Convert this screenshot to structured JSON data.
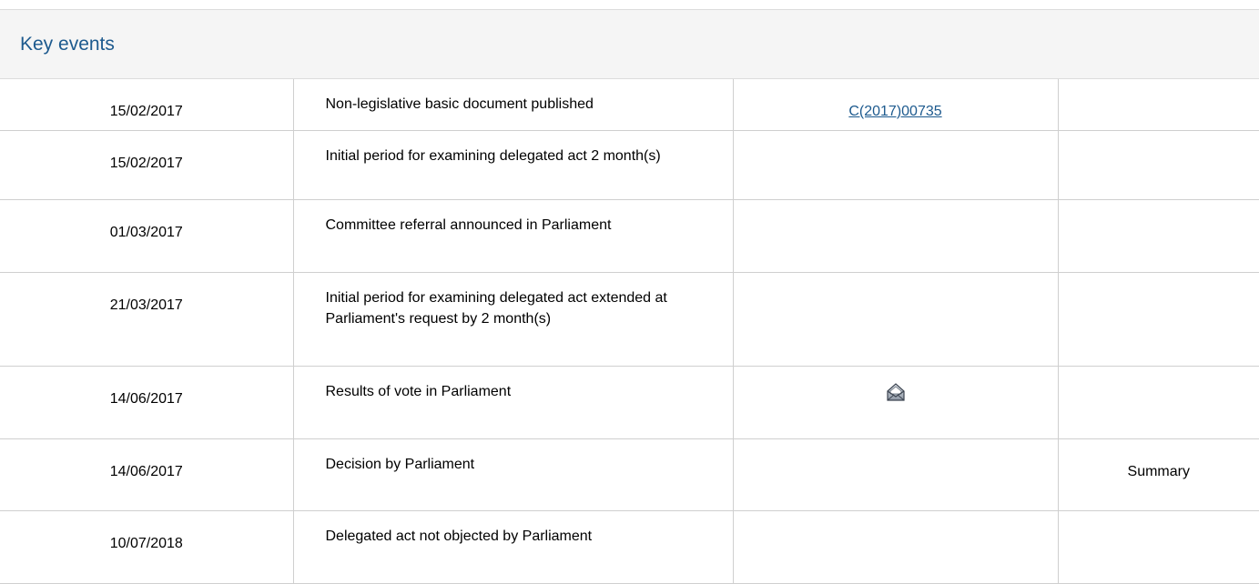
{
  "section": {
    "title": "Key events"
  },
  "events": [
    {
      "date": "15/02/2017",
      "event": "Non-legislative basic document published",
      "reference": "C(2017)00735",
      "summary": ""
    },
    {
      "date": "15/02/2017",
      "event": "Initial period for examining delegated act 2 month(s)",
      "reference": "",
      "summary": ""
    },
    {
      "date": "01/03/2017",
      "event": "Committee referral announced in Parliament",
      "reference": "",
      "summary": ""
    },
    {
      "date": "21/03/2017",
      "event": "Initial period for examining delegated act extended at Parliament's request by 2 month(s)",
      "reference": "",
      "summary": ""
    },
    {
      "date": "14/06/2017",
      "event": "Results of vote in Parliament",
      "reference_icon": "vote-results-icon",
      "summary": ""
    },
    {
      "date": "14/06/2017",
      "event": "Decision by Parliament",
      "reference": "",
      "summary": "Summary"
    },
    {
      "date": "10/07/2018",
      "event": "Delegated act not objected by Parliament",
      "reference": "",
      "summary": ""
    }
  ],
  "colors": {
    "accent": "#1d5a8e",
    "header_bg": "#f5f5f5",
    "border": "#cfcfcf"
  }
}
